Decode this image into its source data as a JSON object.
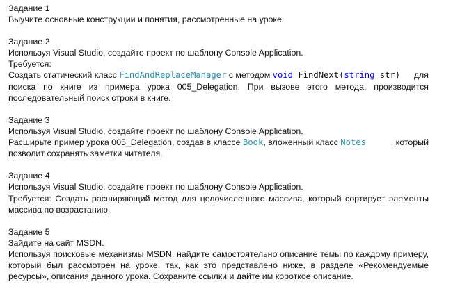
{
  "tasks": [
    {
      "title": "Задание 1",
      "lines": [
        "Выучите основные конструкции  и понятия, рассмотренные на уроке."
      ]
    },
    {
      "title": "Задание 2",
      "intro": "Используя Visual Studio, создайте проект по шаблону Console Application.",
      "requirement_label": "Требуется:",
      "line3_pre": "Создать статический класс ",
      "code_class": "FindAndReplaceManager",
      "line3_mid": " с методом ",
      "code_void": "void",
      "code_method": " FindNext(",
      "code_string": "string",
      "code_param": " str)",
      "line3_post": " для",
      "line4": "поиска по книге из примера урока 005_Delegation. При вызове этого метода, производится",
      "line5": "последовательный поиск строки в книге."
    },
    {
      "title": "Задание 3",
      "intro": "Используя Visual Studio, создайте проект по шаблону Console Application.",
      "line3_pre": "Расширьте пример урока 005_Delegation, создав в классе ",
      "code_book": "Book",
      "line3_mid": ", вложенный класс ",
      "code_notes": "Notes",
      "line3_post": ", который",
      "line4": "позволит сохранять заметки читателя."
    },
    {
      "title": "Задание 4",
      "intro": "Используя Visual Studio, создайте проект по шаблону Console Application.",
      "line3": "Требуется: Создать расширяющий метод для целочисленного массива, который сортирует элементы",
      "line4": "массива по возрастанию."
    },
    {
      "title": "Задание 5",
      "intro": "Зайдите на сайт MSDN.",
      "line3": "Используя поисковые механизмы MSDN, найдите самостоятельно описание темы по каждому примеру,",
      "line4": "который был рассмотрен на уроке, так, как это представлено ниже, в разделе «Рекомендуемые",
      "line5": "ресурсы», описания данного урока. Сохраните ссылки и дайте им короткое описание."
    }
  ],
  "colors": {
    "keyword": "#0000ff",
    "type": "#2b91af",
    "text": "#111111"
  }
}
